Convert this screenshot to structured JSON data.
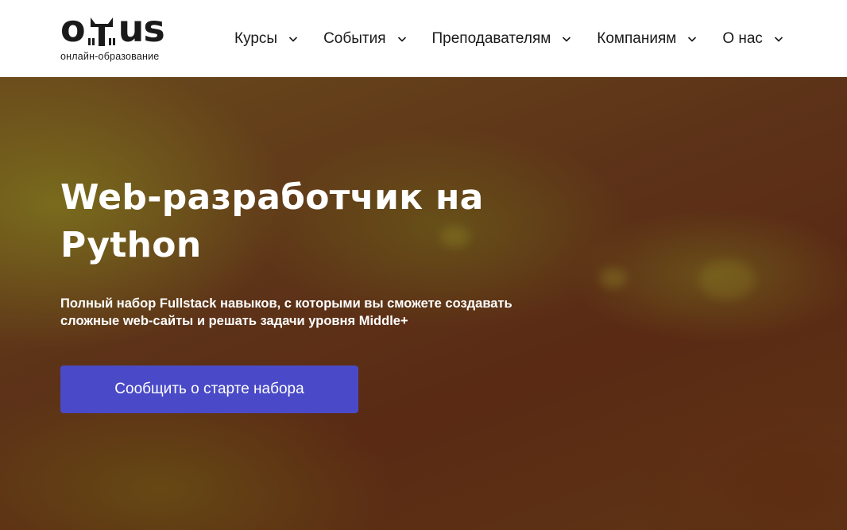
{
  "header": {
    "logo": {
      "letters_left": "o",
      "letters_right": "us",
      "subtitle": "онлайн-образование"
    },
    "nav": [
      {
        "label": "Курсы"
      },
      {
        "label": "События"
      },
      {
        "label": "Преподавателям"
      },
      {
        "label": "Компаниям"
      },
      {
        "label": "О нас"
      }
    ]
  },
  "hero": {
    "title": "Web-разработчик на Python",
    "subtitle": "Полный набор Fullstack навыков, с которыми вы сможете создавать сложные web-сайты и решать задачи уровня Middle+",
    "cta_label": "Сообщить о старте набора"
  },
  "colors": {
    "cta_background": "#4a4ac8",
    "text_dark": "#1a1a1a",
    "hero_text": "#ffffff"
  },
  "icons": {
    "owl": "owl-logo-icon",
    "chevron": "chevron-down-icon"
  }
}
